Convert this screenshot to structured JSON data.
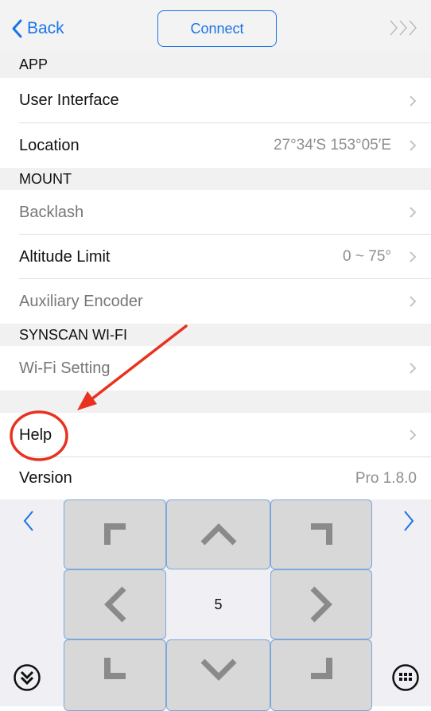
{
  "nav": {
    "back_label": "Back",
    "connect_label": "Connect"
  },
  "sections": {
    "app": "APP",
    "mount": "MOUNT",
    "wifi": "SYNSCAN WI-FI"
  },
  "rows": {
    "user_interface": {
      "label": "User Interface"
    },
    "location": {
      "label": "Location",
      "value": "27°34′S 153°05′E"
    },
    "backlash": {
      "label": "Backlash"
    },
    "altitude_limit": {
      "label": "Altitude Limit",
      "value": "0 ~ 75°"
    },
    "auxiliary_encoder": {
      "label": "Auxiliary Encoder"
    },
    "wifi_setting": {
      "label": "Wi-Fi Setting"
    },
    "help": {
      "label": "Help"
    },
    "version": {
      "label": "Version",
      "value": "Pro 1.8.0"
    }
  },
  "keypad": {
    "speed": "5"
  },
  "colors": {
    "accent": "#1a74e8",
    "annotation": "#e8321f"
  }
}
